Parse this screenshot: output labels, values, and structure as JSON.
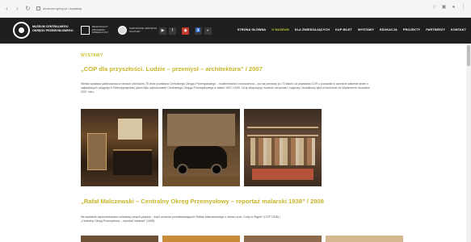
{
  "browser": {
    "address": "muzeum.tychy.pl / wystawy"
  },
  "header": {
    "logo_text": "Muzeum Centralnego Okręgu Przemysłowego",
    "partners": [
      {
        "text": "Regionalny Program Operacyjny"
      },
      {
        "text": "Narodowe Centrum Kultury"
      }
    ],
    "menu": [
      {
        "label": "Strona główna",
        "active": false
      },
      {
        "label": "O muzeum",
        "active": true
      },
      {
        "label": "Dla zwiedzających",
        "active": false
      },
      {
        "label": "Kup bilet",
        "active": false
      },
      {
        "label": "Wystawy",
        "active": false
      },
      {
        "label": "Edukacja",
        "active": false
      },
      {
        "label": "Projekty",
        "active": false
      },
      {
        "label": "Partnerzy",
        "active": false
      },
      {
        "label": "Kontakt",
        "active": false
      }
    ],
    "icons": [
      "youtube-icon",
      "facebook-icon",
      "instagram-icon",
      "accessibility-icon",
      "contrast-icon"
    ]
  },
  "content": {
    "section_label": "WYSTAWY",
    "exhibitions": [
      {
        "title": "„COP dla przyszłości. Ludzie – przemysł – architektura” / 2007",
        "description": "Wielka wystawa jubileuszowa w ramach obchodów 70-lecia powstania Centralnego Okręgu Przemysłowego – multimedialna i nowoczesna – po raz pierwszy po 70 latach od powstania COP-u pokazała w szerokim zakresie jeden z największych osiągnięć II Rzeczypospolitej, jakim było wybudowanie Centralnego Okręgu Przemysłowego w latach 1937–1939. Za tę ekspozycję muzeum otrzymało I nagrodę i dodatkowy tytuł w konkursie na Wydarzenie muzealne 2007 roku."
      },
      {
        "title": "„Rafał Malczewski – Centralny Okręg Przemysłowy – reportaż malarski 1938” / 2008",
        "description": "Na wystawie zaprezentowano unikatowy zespół pejzaży – kopii obrazów przedstawiających Rafała Malczewskiego z okresu prac „Cudy w Stępie” (COP 1938) i „Centralny Okręg Przemysłowy – reportaż malarski” (1938)."
      }
    ]
  },
  "colors": {
    "accent": "#c9b52a",
    "header_bg": "#1f1f1f"
  }
}
